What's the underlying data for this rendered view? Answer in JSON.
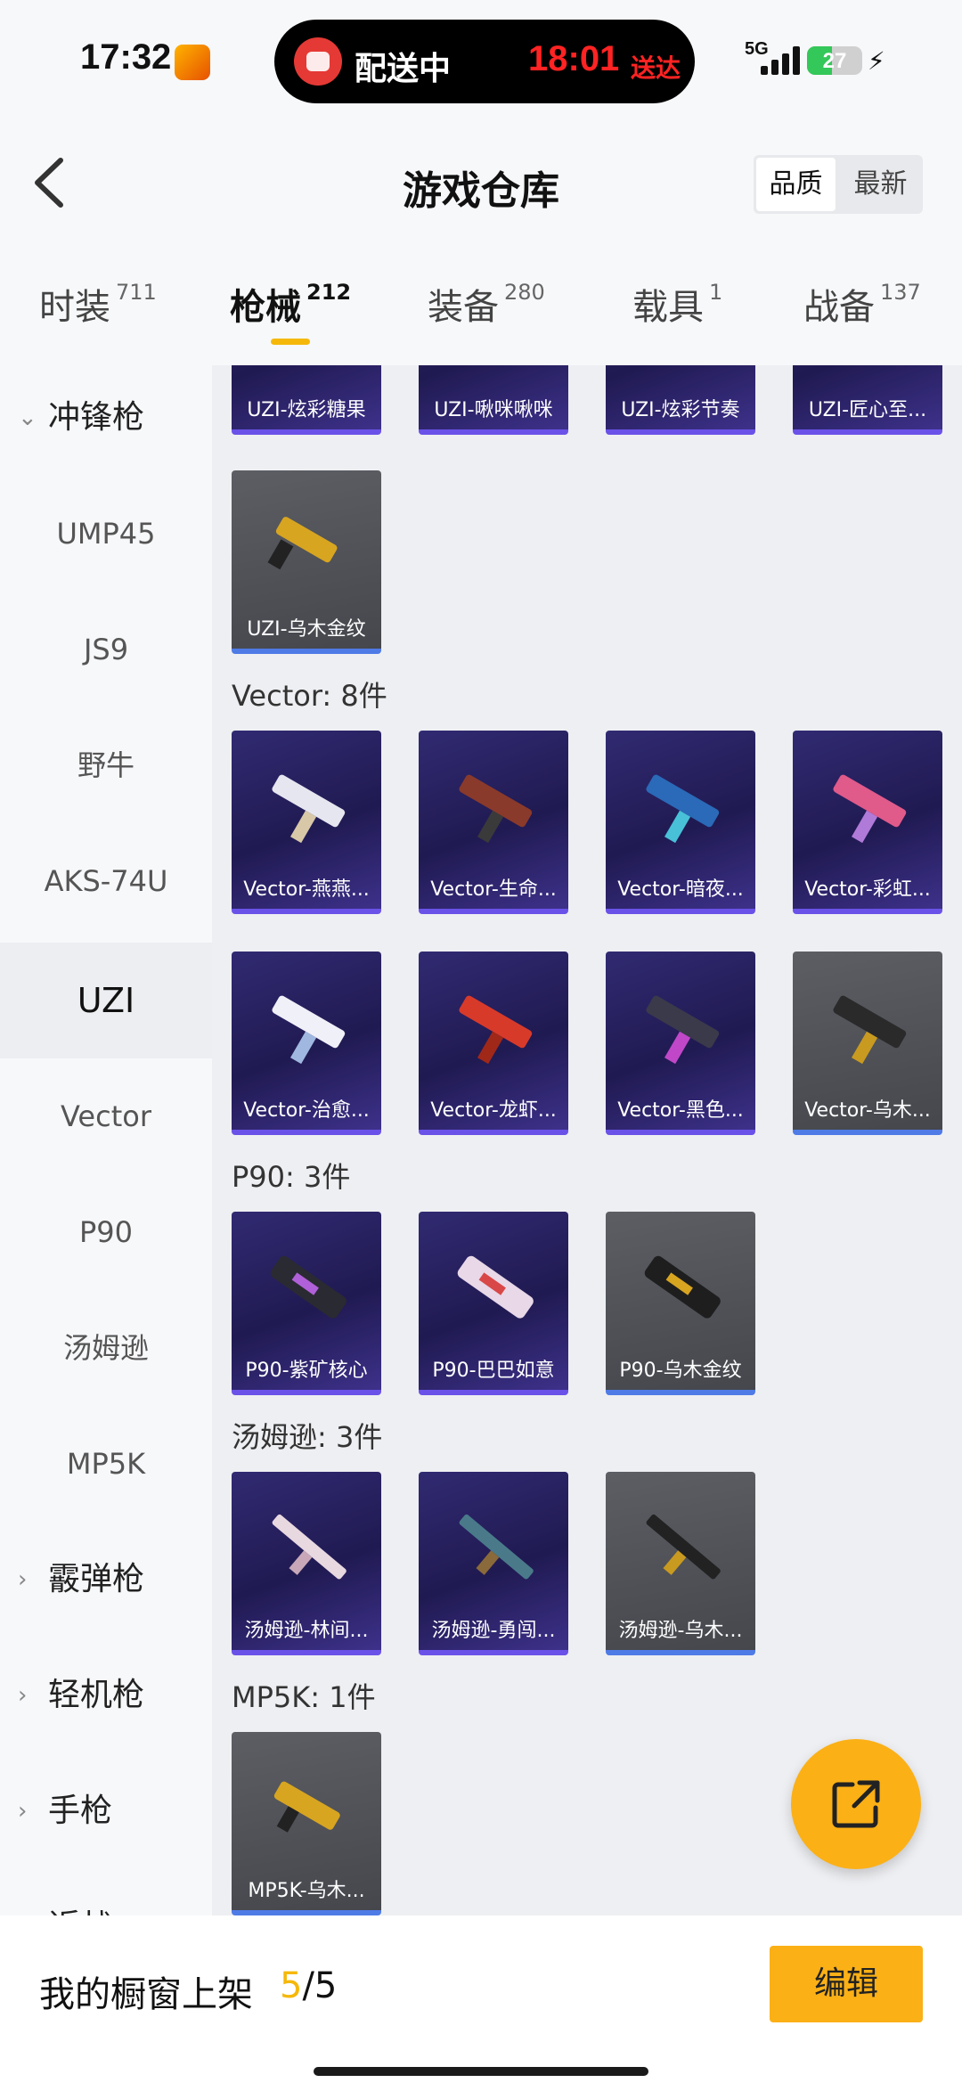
{
  "status_bar": {
    "time": "17:32",
    "island_label": "配送中",
    "island_time": "18:01",
    "island_time_suffix": "送达",
    "network": "5G",
    "battery": "27"
  },
  "header": {
    "title": "游戏仓库",
    "sort_options": [
      "品质",
      "最新"
    ],
    "sort_selected": "品质"
  },
  "tabs": [
    {
      "label": "时装",
      "count": "711"
    },
    {
      "label": "枪械",
      "count": "212",
      "active": true
    },
    {
      "label": "装备",
      "count": "280"
    },
    {
      "label": "载具",
      "count": "1"
    },
    {
      "label": "战备",
      "count": "137"
    }
  ],
  "sidebar": {
    "group_expanded": "冲锋枪",
    "items": [
      "UMP45",
      "JS9",
      "野牛",
      "AKS-74U",
      "UZI",
      "Vector",
      "P90",
      "汤姆逊",
      "MP5K"
    ],
    "active": "UZI",
    "collapsed_groups": [
      "霰弹枪",
      "轻机枪",
      "手枪",
      "近战"
    ]
  },
  "content": {
    "uzi_partial_cards": [
      "UZI-炫彩糖果",
      "UZI-啾咪啾咪",
      "UZI-炫彩节奏",
      "UZI-匠心至..."
    ],
    "uzi_cards_row2": [
      "UZI-乌木金纹"
    ],
    "sections": [
      {
        "heading": "Vector: 8件",
        "cards": [
          "Vector-燕燕...",
          "Vector-生命...",
          "Vector-暗夜...",
          "Vector-彩虹...",
          "Vector-治愈...",
          "Vector-龙虾...",
          "Vector-黑色...",
          "Vector-乌木..."
        ]
      },
      {
        "heading": "P90: 3件",
        "cards": [
          "P90-紫矿核心",
          "P90-巴巴如意",
          "P90-乌木金纹"
        ]
      },
      {
        "heading": "汤姆逊: 3件",
        "cards": [
          "汤姆逊-林间...",
          "汤姆逊-勇闯...",
          "汤姆逊-乌木..."
        ]
      },
      {
        "heading": "MP5K: 1件",
        "cards": [
          "MP5K-乌木..."
        ]
      }
    ]
  },
  "bottom_bar": {
    "label": "我的橱窗上架",
    "count_current": "5",
    "count_sep_total": "/5",
    "edit_label": "编辑"
  },
  "colors": {
    "accent": "#f5b80a",
    "card_purple": "#2a2362",
    "card_gold_bg": "#515359"
  },
  "icons": [
    "back-arrow-icon",
    "share-icon",
    "bolt-icon",
    "chevron-down-icon",
    "chevron-right-icon"
  ]
}
